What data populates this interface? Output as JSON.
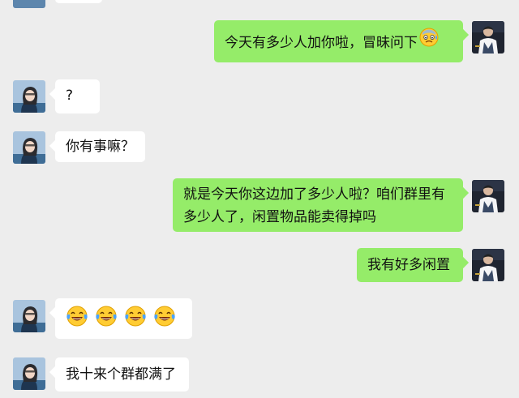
{
  "chat": {
    "messages": [
      {
        "sender": "me",
        "text": "今天有多少人加你啦，冒昧问下",
        "emoji": "sweat-anxious-face-icon"
      },
      {
        "sender": "contact",
        "text": "?"
      },
      {
        "sender": "contact",
        "text": "你有事嘛？"
      },
      {
        "sender": "me",
        "lines": [
          "就是今天你这边加了多少人啦？咱们群里有",
          "多少人了，闲置物品能卖得掉吗"
        ]
      },
      {
        "sender": "me",
        "text": "我有好多闲置"
      },
      {
        "sender": "contact",
        "emojis": [
          "tears-of-joy-icon",
          "tears-of-joy-icon",
          "tears-of-joy-icon",
          "tears-of-joy-icon"
        ]
      },
      {
        "sender": "contact",
        "text": "我十来个群都满了"
      }
    ]
  },
  "colors": {
    "background": "#ededed",
    "my_bubble": "#95ec69",
    "their_bubble": "#ffffff",
    "text": "#111111"
  }
}
